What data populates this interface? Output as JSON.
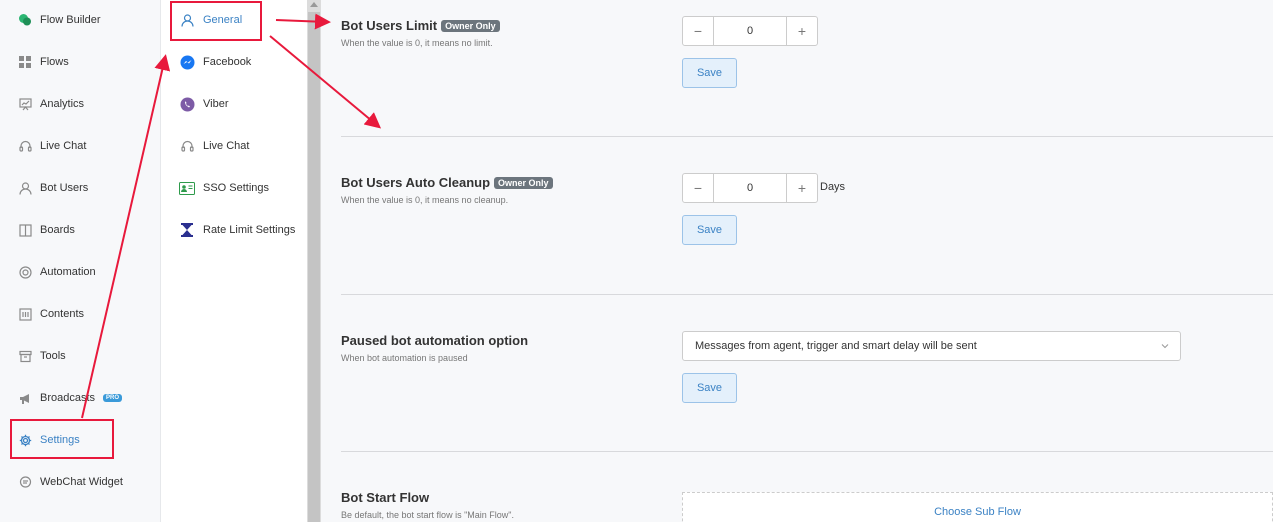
{
  "sidebar": {
    "items": [
      {
        "label": "Flow Builder",
        "icon": "chat-bubbles-icon"
      },
      {
        "label": "Flows",
        "icon": "grid-icon"
      },
      {
        "label": "Analytics",
        "icon": "presentation-icon"
      },
      {
        "label": "Live Chat",
        "icon": "headset-icon"
      },
      {
        "label": "Bot Users",
        "icon": "user-icon"
      },
      {
        "label": "Boards",
        "icon": "board-icon"
      },
      {
        "label": "Automation",
        "icon": "automation-icon"
      },
      {
        "label": "Contents",
        "icon": "contents-icon"
      },
      {
        "label": "Tools",
        "icon": "archive-icon"
      },
      {
        "label": "Broadcasts",
        "icon": "megaphone-icon",
        "badge": "PRO"
      },
      {
        "label": "Settings",
        "icon": "gear-icon",
        "active": true
      },
      {
        "label": "WebChat Widget",
        "icon": "chat-icon"
      }
    ]
  },
  "submenu": {
    "items": [
      {
        "label": "General",
        "icon": "user-icon",
        "active": true
      },
      {
        "label": "Facebook",
        "icon": "messenger-icon"
      },
      {
        "label": "Viber",
        "icon": "viber-icon"
      },
      {
        "label": "Live Chat",
        "icon": "headset-icon"
      },
      {
        "label": "SSO Settings",
        "icon": "id-card-icon"
      },
      {
        "label": "Rate Limit Settings",
        "icon": "hourglass-icon"
      }
    ]
  },
  "main": {
    "bot_users_limit": {
      "title": "Bot Users Limit",
      "badge": "Owner Only",
      "description": "When the value is 0, it means no limit.",
      "value": "0",
      "save_label": "Save"
    },
    "bot_users_cleanup": {
      "title": "Bot Users Auto Cleanup",
      "badge": "Owner Only",
      "description": "When the value is 0, it means no cleanup.",
      "value": "0",
      "unit": "Days",
      "save_label": "Save"
    },
    "paused_automation": {
      "title": "Paused bot automation option",
      "description": "When bot automation is paused",
      "selected": "Messages from agent, trigger and smart delay will be sent",
      "save_label": "Save"
    },
    "bot_start_flow": {
      "title": "Bot Start Flow",
      "description": "Be default, the bot start flow is \"Main Flow\".",
      "choose_label": "Choose Sub Flow"
    }
  },
  "colors": {
    "accent": "#3b82c4",
    "annotation": "#e8193c",
    "badge": "#6c757d"
  }
}
